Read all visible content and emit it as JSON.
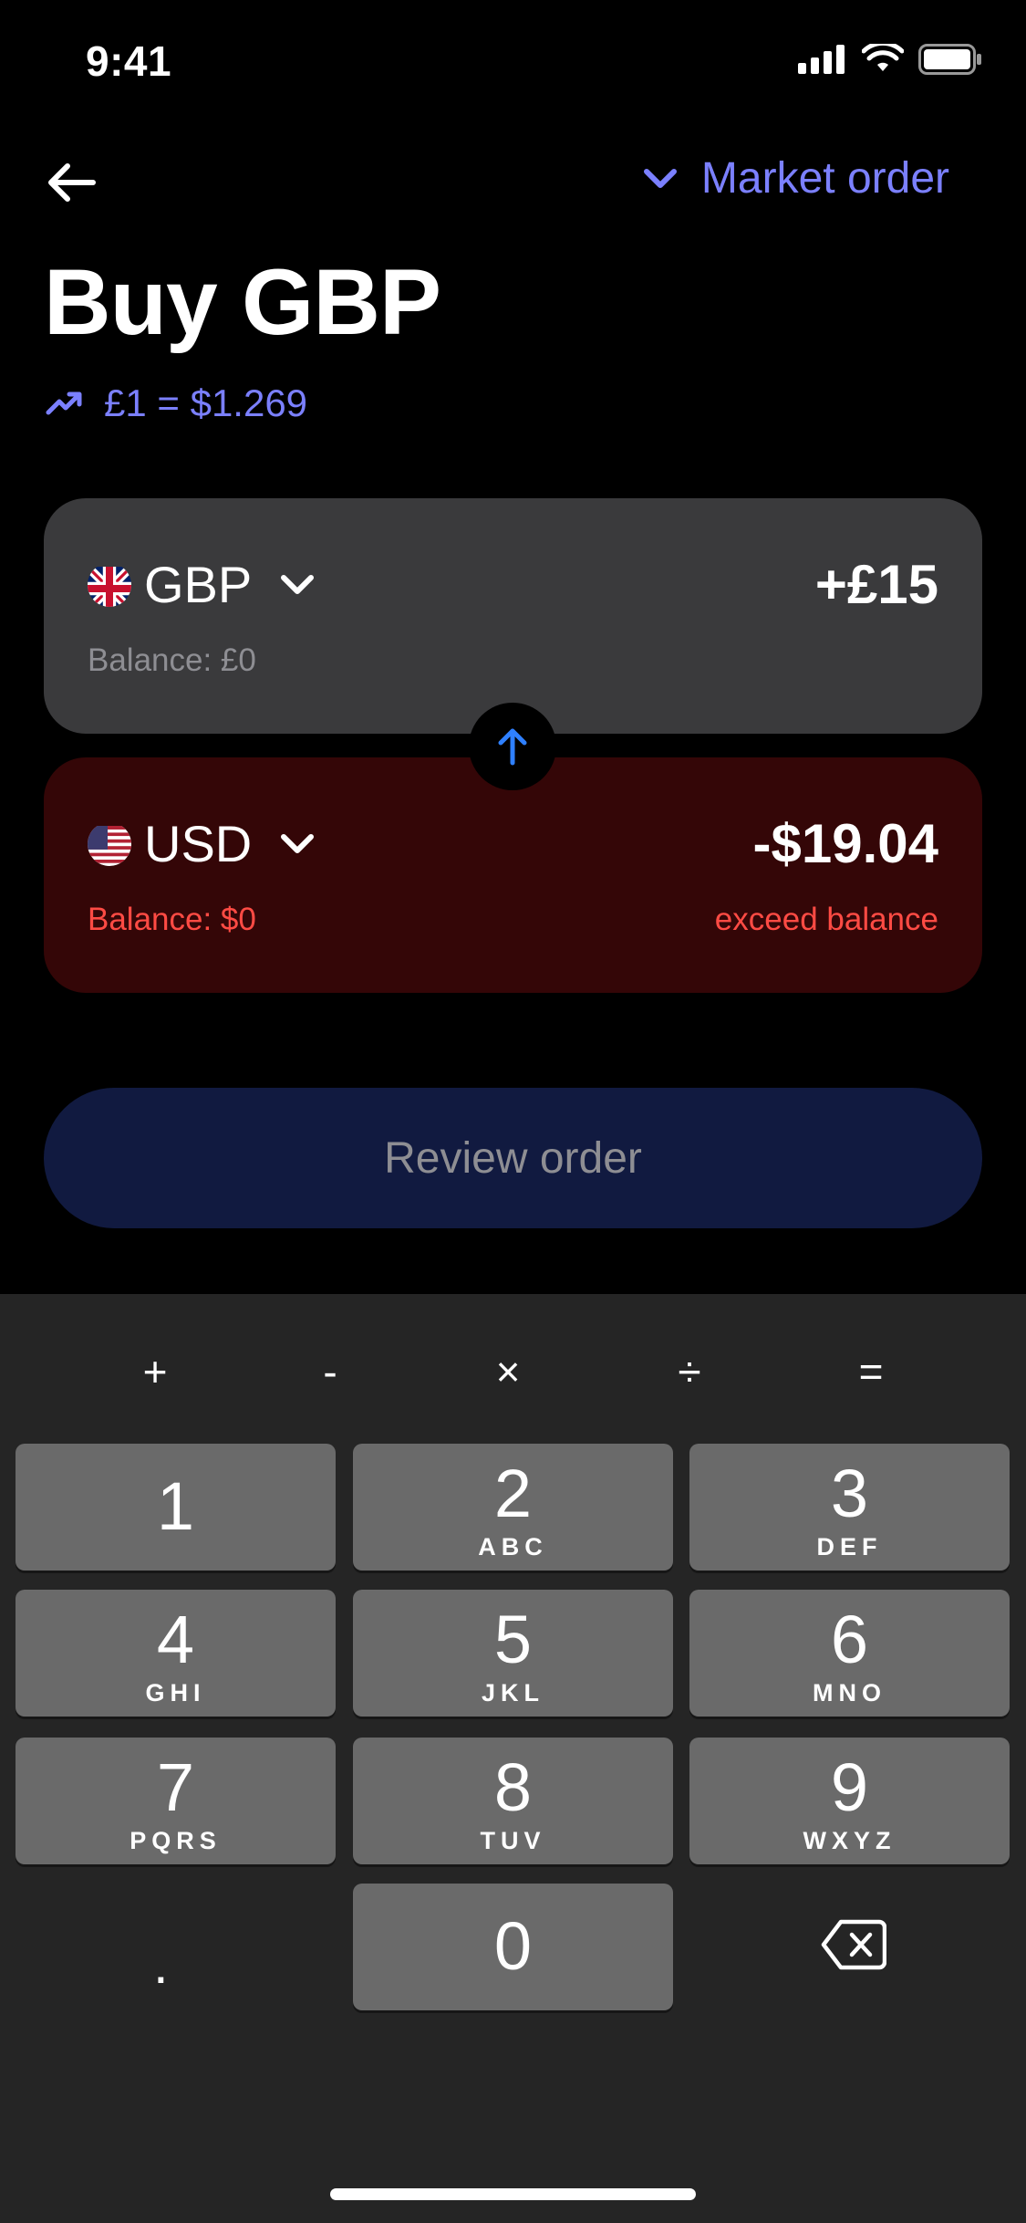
{
  "status": {
    "time": "9:41"
  },
  "header": {
    "order_type": "Market order",
    "title": "Buy GBP",
    "rate": "£1 = $1.269"
  },
  "from_card": {
    "currency": "GBP",
    "amount": "+£15",
    "balance": "Balance: £0"
  },
  "to_card": {
    "currency": "USD",
    "amount": "-$19.04",
    "balance": "Balance: $0",
    "warning": "exceed balance"
  },
  "review_button": {
    "label": "Review order"
  },
  "keyboard": {
    "operators": [
      "+",
      "-",
      "×",
      "÷",
      "="
    ],
    "keys": [
      {
        "digit": "1",
        "letters": ""
      },
      {
        "digit": "2",
        "letters": "ABC"
      },
      {
        "digit": "3",
        "letters": "DEF"
      },
      {
        "digit": "4",
        "letters": "GHI"
      },
      {
        "digit": "5",
        "letters": "JKL"
      },
      {
        "digit": "6",
        "letters": "MNO"
      },
      {
        "digit": "7",
        "letters": "PQRS"
      },
      {
        "digit": "8",
        "letters": "TUV"
      },
      {
        "digit": "9",
        "letters": "WXYZ"
      },
      {
        "digit": "0",
        "letters": ""
      }
    ],
    "decimal": ".",
    "delete_icon": "backspace-icon"
  },
  "colors": {
    "accent": "#7B80FF",
    "error": "#FF4B44",
    "card": "#3A3A3C",
    "error_card": "#340607",
    "review_button": "#111A40",
    "swap_arrow": "#2F80FF"
  }
}
